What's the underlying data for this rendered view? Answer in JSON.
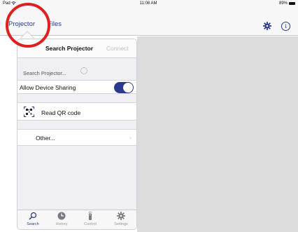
{
  "status_bar": {
    "device": "Pad",
    "time": "11:08 AM",
    "battery": "89%"
  },
  "nav": {
    "tabs": [
      "Projector",
      "Files"
    ],
    "icons": {
      "settings": "gear-icon",
      "info": "info-icon"
    },
    "info_glyph": "i",
    "accent_color": "#2a3a8f",
    "highlight_color": "#e02020"
  },
  "popover": {
    "title": "Search Projector",
    "connect_label": "Connect",
    "searching_label": "Search Projector...",
    "sharing": {
      "label": "Allow Device Sharing",
      "enabled": true
    },
    "qr_label": "Read QR code",
    "other_label": "Other...",
    "chevron": "›",
    "tabbar": [
      {
        "label": "Search",
        "icon": "search-icon",
        "active": true
      },
      {
        "label": "History",
        "icon": "clock-icon",
        "active": false
      },
      {
        "label": "Control",
        "icon": "remote-icon",
        "active": false
      },
      {
        "label": "Settings",
        "icon": "gear-icon",
        "active": false
      }
    ]
  }
}
